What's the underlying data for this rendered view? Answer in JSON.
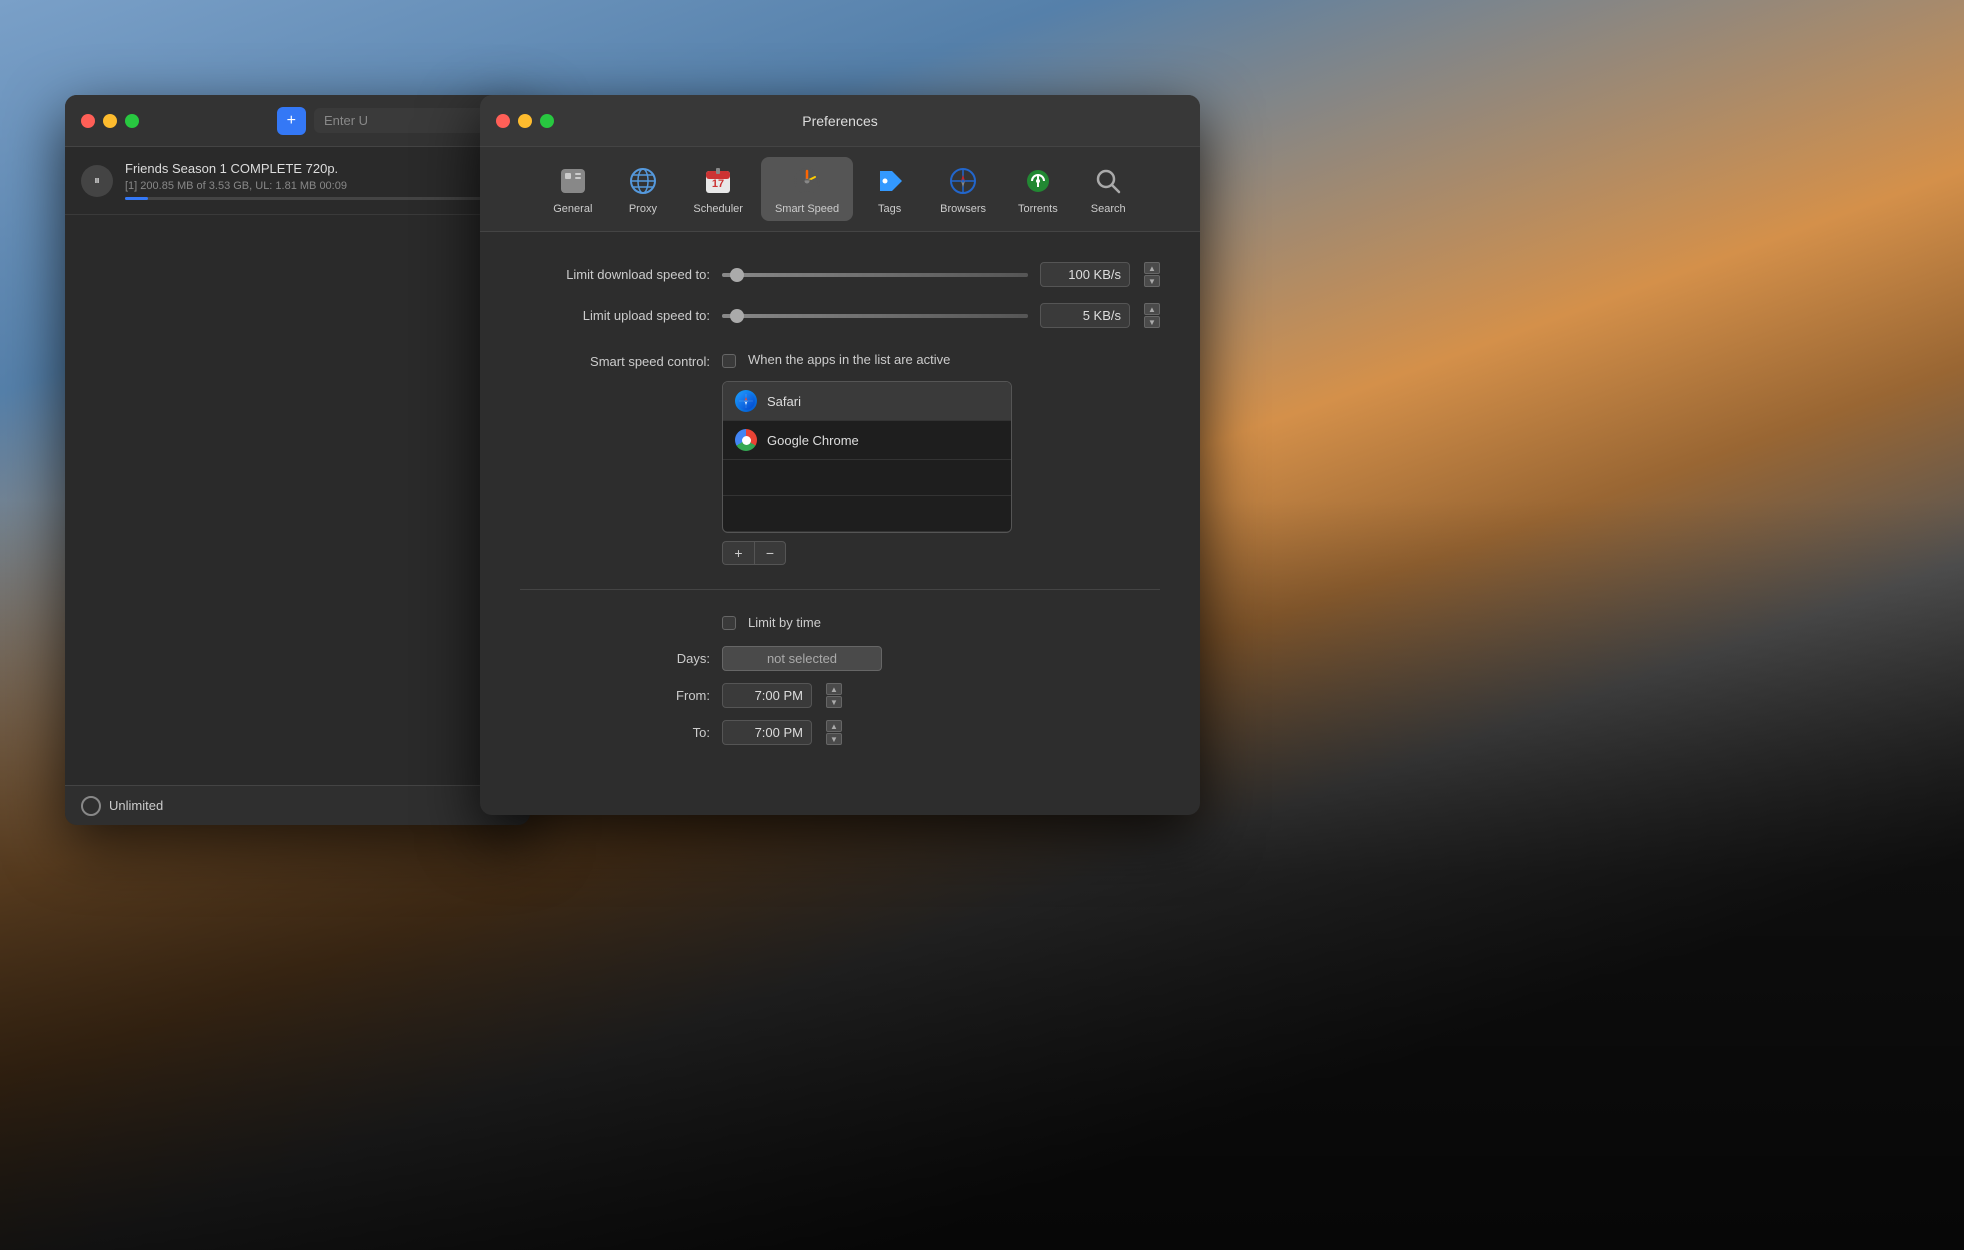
{
  "background": {
    "gradient": "city skyline"
  },
  "torrent_window": {
    "title": "",
    "url_placeholder": "Enter U",
    "add_button_label": "+",
    "torrent": {
      "name": "Friends Season 1 COMPLETE 720p.",
      "meta": "[1] 200.85 MB of 3.53 GB, UL: 1.81 MB 00:09",
      "progress": 6
    },
    "footer": {
      "speed_label": "Unlimited"
    }
  },
  "preferences_window": {
    "title": "Preferences",
    "toolbar": {
      "items": [
        {
          "id": "general",
          "label": "General",
          "icon": "⬜"
        },
        {
          "id": "proxy",
          "label": "Proxy",
          "icon": "🌐"
        },
        {
          "id": "scheduler",
          "label": "Scheduler",
          "icon": "📅"
        },
        {
          "id": "smart_speed",
          "label": "Smart Speed",
          "icon": "⏱",
          "active": true
        },
        {
          "id": "tags",
          "label": "Tags",
          "icon": "🏷"
        },
        {
          "id": "browsers",
          "label": "Browsers",
          "icon": "🧭"
        },
        {
          "id": "torrents",
          "label": "Torrents",
          "icon": "⚙"
        },
        {
          "id": "search",
          "label": "Search",
          "icon": "🔍"
        }
      ]
    },
    "smart_speed": {
      "download_label": "Limit download speed to:",
      "download_value": "100 KB/s",
      "upload_label": "Limit upload speed to:",
      "upload_value": "5 KB/s",
      "smart_speed_label": "Smart speed control:",
      "smart_speed_desc": "When the apps in the list are active",
      "apps": [
        {
          "name": "Safari",
          "icon": "safari"
        },
        {
          "name": "Google Chrome",
          "icon": "chrome"
        }
      ],
      "add_btn": "+",
      "remove_btn": "−",
      "limit_time_label": "Limit by time",
      "days_label": "Days:",
      "days_value": "not selected",
      "from_label": "From:",
      "from_value": "7:00 PM",
      "to_label": "To:",
      "to_value": "7:00 PM"
    }
  }
}
